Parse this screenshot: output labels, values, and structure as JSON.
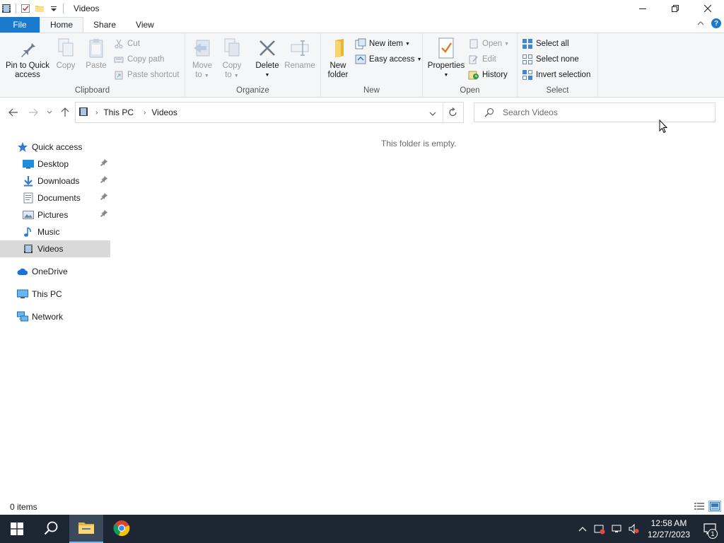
{
  "window": {
    "title": "Videos"
  },
  "ribbon_tabs": [
    {
      "label": "File"
    },
    {
      "label": "Home"
    },
    {
      "label": "Share"
    },
    {
      "label": "View"
    }
  ],
  "ribbon": {
    "clipboard": {
      "pin_label_1": "Pin to Quick",
      "pin_label_2": "access",
      "copy": "Copy",
      "paste": "Paste",
      "cut": "Cut",
      "copy_path": "Copy path",
      "paste_shortcut": "Paste shortcut",
      "group": "Clipboard"
    },
    "organize": {
      "move_to_1": "Move",
      "move_to_2": "to",
      "copy_to_1": "Copy",
      "copy_to_2": "to",
      "delete": "Delete",
      "rename": "Rename",
      "group": "Organize"
    },
    "new": {
      "new_folder_1": "New",
      "new_folder_2": "folder",
      "new_item": "New item",
      "easy_access": "Easy access",
      "group": "New"
    },
    "open": {
      "properties": "Properties",
      "open": "Open",
      "edit": "Edit",
      "history": "History",
      "group": "Open"
    },
    "select": {
      "select_all": "Select all",
      "select_none": "Select none",
      "invert_selection": "Invert selection",
      "group": "Select"
    }
  },
  "address": {
    "crumbs": [
      "This PC",
      "Videos"
    ]
  },
  "search": {
    "placeholder": "Search Videos"
  },
  "nav_pane": {
    "quick_access": "Quick access",
    "items": [
      {
        "label": "Desktop",
        "icon": "desktop-icon",
        "pinned": true
      },
      {
        "label": "Downloads",
        "icon": "downloads-icon",
        "pinned": true
      },
      {
        "label": "Documents",
        "icon": "documents-icon",
        "pinned": true
      },
      {
        "label": "Pictures",
        "icon": "pictures-icon",
        "pinned": true
      },
      {
        "label": "Music",
        "icon": "music-icon",
        "pinned": false
      },
      {
        "label": "Videos",
        "icon": "videos-icon",
        "pinned": false
      }
    ],
    "onedrive": "OneDrive",
    "this_pc": "This PC",
    "network": "Network"
  },
  "content": {
    "empty_message": "This folder is empty."
  },
  "status": {
    "items": "0 items"
  },
  "taskbar": {
    "time": "12:58 AM",
    "date": "12/27/2023",
    "notification_count": "1"
  },
  "colors": {
    "accent": "#1979ca",
    "taskbar": "#1c2733",
    "selected": "#d9d9d9"
  }
}
